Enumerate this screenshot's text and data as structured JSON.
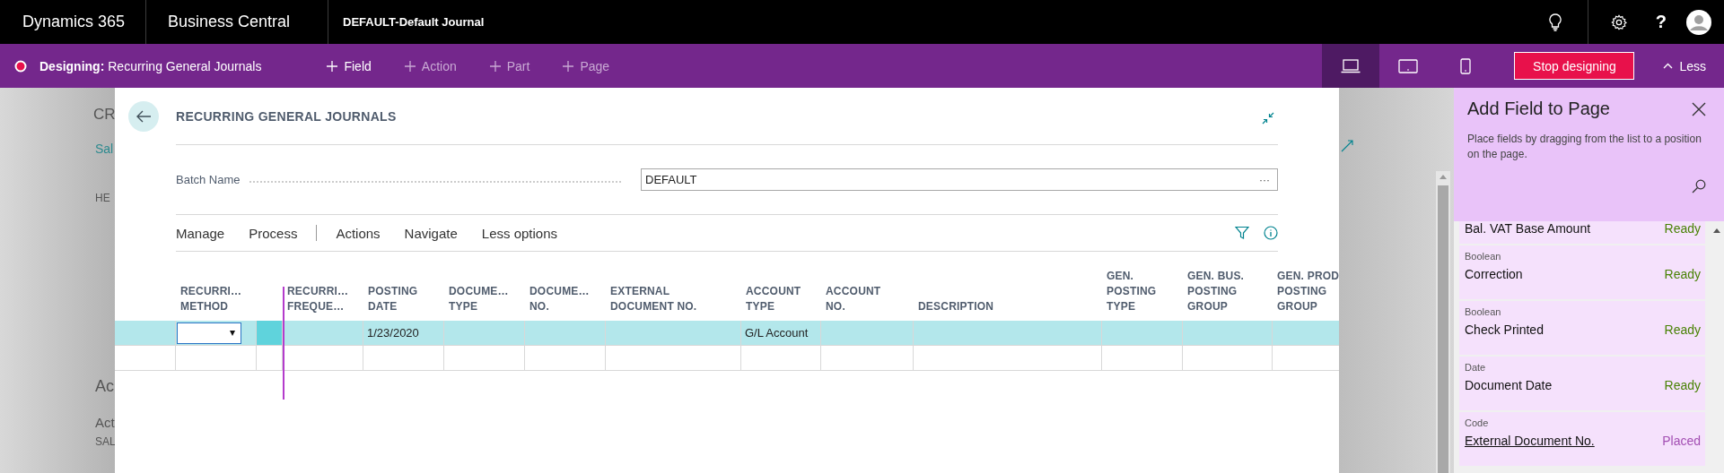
{
  "top_bar": {
    "product": "Dynamics 365",
    "app": "Business Central",
    "context": "DEFAULT-Default Journal",
    "help": "?"
  },
  "design_bar": {
    "label": "Designing:",
    "page": "Recurring General Journals",
    "actions": [
      {
        "label": "Field",
        "disabled": false
      },
      {
        "label": "Action",
        "disabled": true
      },
      {
        "label": "Part",
        "disabled": true
      },
      {
        "label": "Page",
        "disabled": true
      }
    ],
    "devices": [
      {
        "kind": "desktop",
        "selected": true
      },
      {
        "kind": "tablet",
        "selected": false
      },
      {
        "kind": "phone",
        "selected": false
      }
    ],
    "stop_button": "Stop designing",
    "less": "Less"
  },
  "background_page": {
    "texts": [
      "CR",
      "Sal",
      "HE",
      "Ac",
      "Act",
      "SAL"
    ]
  },
  "dialog": {
    "title": "RECURRING GENERAL JOURNALS",
    "batch_name": {
      "label": "Batch Name",
      "value": "DEFAULT",
      "more": "···"
    },
    "menu_groups": [
      [
        "Manage",
        "Process"
      ],
      [
        "Actions",
        "Navigate",
        "Less options"
      ]
    ],
    "table": {
      "columns": [
        {
          "header": "RECURRI…\nMETHOD"
        },
        {
          "header": "RECURRI…\nFREQUE…"
        },
        {
          "header": "POSTING\nDATE"
        },
        {
          "header": "DOCUME…\nTYPE"
        },
        {
          "header": "DOCUME…\nNO."
        },
        {
          "header": "EXTERNAL\nDOCUMENT NO."
        },
        {
          "header": "ACCOUNT\nTYPE"
        },
        {
          "header": "ACCOUNT\nNO."
        },
        {
          "header": "DESCRIPTION"
        },
        {
          "header": "GEN.\nPOSTING\nTYPE"
        },
        {
          "header": "GEN. BUS.\nPOSTING\nGROUP"
        },
        {
          "header": "GEN. PROD\nPOSTING\nGROUP"
        }
      ],
      "rows": [
        {
          "selected": true,
          "dropdown": true,
          "cells": [
            null,
            null,
            "1/23/2020",
            null,
            null,
            null,
            "G/L Account",
            null,
            null,
            null,
            null,
            null
          ]
        },
        {
          "selected": false,
          "dropdown": false
        }
      ]
    }
  },
  "panel": {
    "title": "Add Field to Page",
    "description": "Place fields by dragging from the list to a position on the page.",
    "fields": [
      {
        "name": "Bal. VAT Base Amount",
        "status": "Ready",
        "placed": false
      },
      {
        "type": "Boolean",
        "name": "Correction",
        "status": "Ready",
        "placed": false
      },
      {
        "type": "Boolean",
        "name": "Check Printed",
        "status": "Ready",
        "placed": false
      },
      {
        "type": "Date",
        "name": "Document Date",
        "status": "Ready",
        "placed": false
      },
      {
        "type": "Code",
        "name": "External Document No.",
        "status": "Placed",
        "placed": true
      }
    ]
  }
}
